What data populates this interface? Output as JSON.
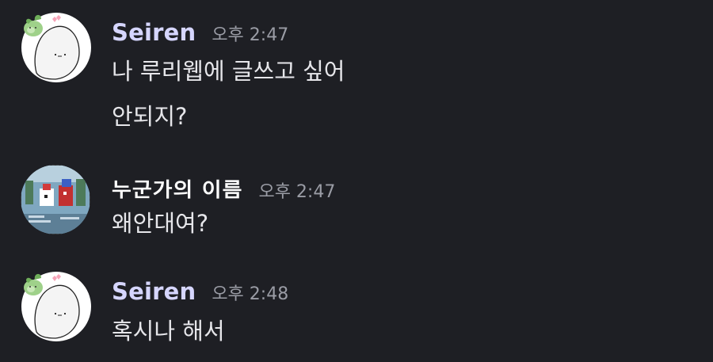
{
  "messages": [
    {
      "author": "Seiren",
      "time": "오후 2:47",
      "avatar_icon": "mochi-blob-with-sprout-avatar",
      "lines": [
        "나 루리웹에 글쓰고 싶어",
        "안되지?"
      ]
    },
    {
      "author": "누군가의 이름",
      "time": "오후 2:47",
      "avatar_icon": "pixel-game-screenshot-avatar",
      "lines": [
        "왜안대여?"
      ]
    },
    {
      "author": "Seiren",
      "time": "오후 2:48",
      "avatar_icon": "mochi-blob-with-sprout-avatar",
      "lines": [
        "혹시나 해서"
      ]
    }
  ],
  "colors": {
    "background": "#1e1f24",
    "username": "#d6d6ff",
    "timestamp": "#9a9ca5",
    "text": "#e6e6ea"
  }
}
